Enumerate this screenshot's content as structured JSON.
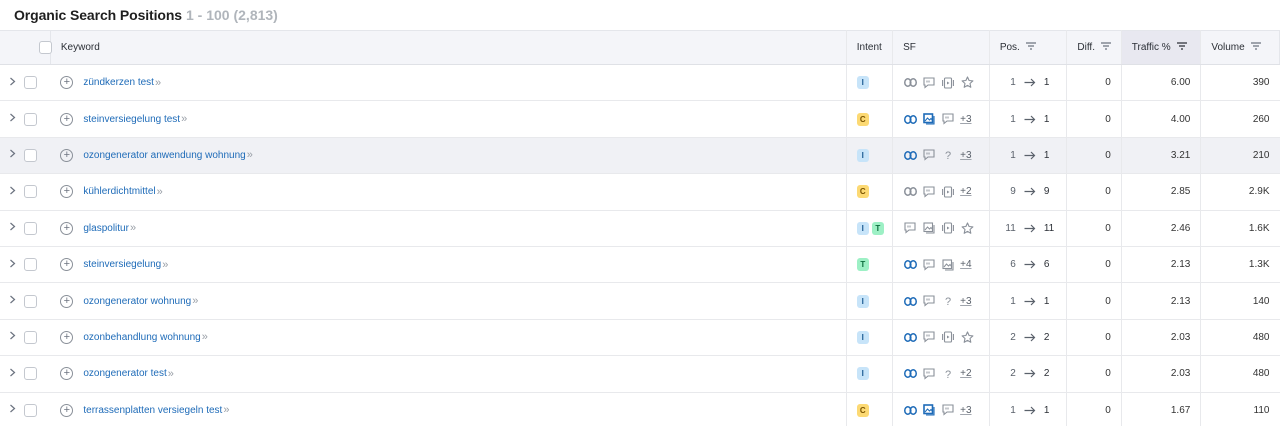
{
  "header": {
    "title": "Organic Search Positions",
    "range": "1 - 100 (2,813)"
  },
  "columns": {
    "keyword": "Keyword",
    "intent": "Intent",
    "sf": "SF",
    "pos": "Pos.",
    "diff": "Diff.",
    "traffic": "Traffic %",
    "volume": "Volume"
  },
  "rows": [
    {
      "keyword": "zündkerzen test",
      "intent": [
        "I"
      ],
      "sf": [
        "link",
        "review",
        "video",
        "star"
      ],
      "more": "",
      "pos_from": "1",
      "pos_to": "1",
      "diff": "0",
      "traffic": "6.00",
      "volume": "390",
      "highlighted": false
    },
    {
      "keyword": "steinversiegelung test",
      "intent": [
        "C"
      ],
      "sf": [
        "link-blue",
        "image-blue",
        "review"
      ],
      "more": "+3",
      "pos_from": "1",
      "pos_to": "1",
      "diff": "0",
      "traffic": "4.00",
      "volume": "260",
      "highlighted": false
    },
    {
      "keyword": "ozongenerator anwendung wohnung",
      "intent": [
        "I"
      ],
      "sf": [
        "link-blue",
        "review",
        "question"
      ],
      "more": "+3",
      "pos_from": "1",
      "pos_to": "1",
      "diff": "0",
      "traffic": "3.21",
      "volume": "210",
      "highlighted": true
    },
    {
      "keyword": "kühlerdichtmittel",
      "intent": [
        "C"
      ],
      "sf": [
        "link",
        "review",
        "video"
      ],
      "more": "+2",
      "pos_from": "9",
      "pos_to": "9",
      "diff": "0",
      "traffic": "2.85",
      "volume": "2.9K",
      "highlighted": false
    },
    {
      "keyword": "glaspolitur",
      "intent": [
        "I",
        "T"
      ],
      "sf": [
        "review",
        "image",
        "video",
        "star"
      ],
      "more": "",
      "pos_from": "11",
      "pos_to": "11",
      "diff": "0",
      "traffic": "2.46",
      "volume": "1.6K",
      "highlighted": false
    },
    {
      "keyword": "steinversiegelung",
      "intent": [
        "T"
      ],
      "sf": [
        "link-blue",
        "review",
        "image"
      ],
      "more": "+4",
      "pos_from": "6",
      "pos_to": "6",
      "diff": "0",
      "traffic": "2.13",
      "volume": "1.3K",
      "highlighted": false
    },
    {
      "keyword": "ozongenerator wohnung",
      "intent": [
        "I"
      ],
      "sf": [
        "link-blue",
        "review",
        "question"
      ],
      "more": "+3",
      "pos_from": "1",
      "pos_to": "1",
      "diff": "0",
      "traffic": "2.13",
      "volume": "140",
      "highlighted": false
    },
    {
      "keyword": "ozonbehandlung wohnung",
      "intent": [
        "I"
      ],
      "sf": [
        "link-blue",
        "review",
        "video",
        "star"
      ],
      "more": "",
      "pos_from": "2",
      "pos_to": "2",
      "diff": "0",
      "traffic": "2.03",
      "volume": "480",
      "highlighted": false
    },
    {
      "keyword": "ozongenerator test",
      "intent": [
        "I"
      ],
      "sf": [
        "link-blue",
        "review",
        "question"
      ],
      "more": "+2",
      "pos_from": "2",
      "pos_to": "2",
      "diff": "0",
      "traffic": "2.03",
      "volume": "480",
      "highlighted": false
    },
    {
      "keyword": "terrassenplatten versiegeln test",
      "intent": [
        "C"
      ],
      "sf": [
        "link-blue",
        "image-blue",
        "review"
      ],
      "more": "+3",
      "pos_from": "1",
      "pos_to": "1",
      "diff": "0",
      "traffic": "1.67",
      "volume": "110",
      "highlighted": false
    }
  ],
  "colors": {
    "link": "#1e6bb8",
    "icon_gray": "#8a9099",
    "icon_blue": "#1e6bb8",
    "header_bg": "#f4f5f9",
    "row_highlight": "#f0f1f5"
  }
}
